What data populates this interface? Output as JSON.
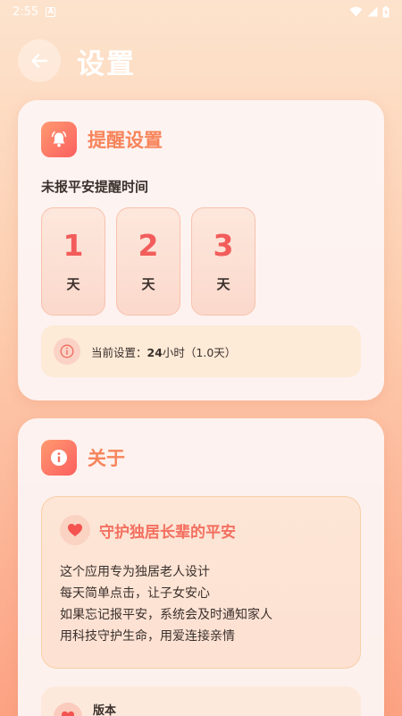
{
  "status_bar": {
    "time": "2:55",
    "notification_icon": "a-icon"
  },
  "header": {
    "title": "设置",
    "back_icon": "arrow-left-icon"
  },
  "reminder_card": {
    "title": "提醒设置",
    "section_label": "未报平安提醒时间",
    "day_options": [
      {
        "value": "1",
        "unit": "天"
      },
      {
        "value": "2",
        "unit": "天"
      },
      {
        "value": "3",
        "unit": "天"
      }
    ],
    "current_prefix": "当前设置：",
    "current_value": "24",
    "current_suffix": "小时（1.0天）"
  },
  "about_card": {
    "title": "关于",
    "mission_title": "守护独居长辈的平安",
    "mission_lines": [
      "这个应用专为独居老人设计",
      "每天简单点击，让子女安心",
      "如果忘记报平安，系统会及时通知家人",
      "用科技守护生命，用爱连接亲情"
    ],
    "version_label": "版本"
  },
  "colors": {
    "accent": "#f7845a",
    "accent_red": "#f25d5b",
    "card_bg": "#fdf4f2"
  }
}
